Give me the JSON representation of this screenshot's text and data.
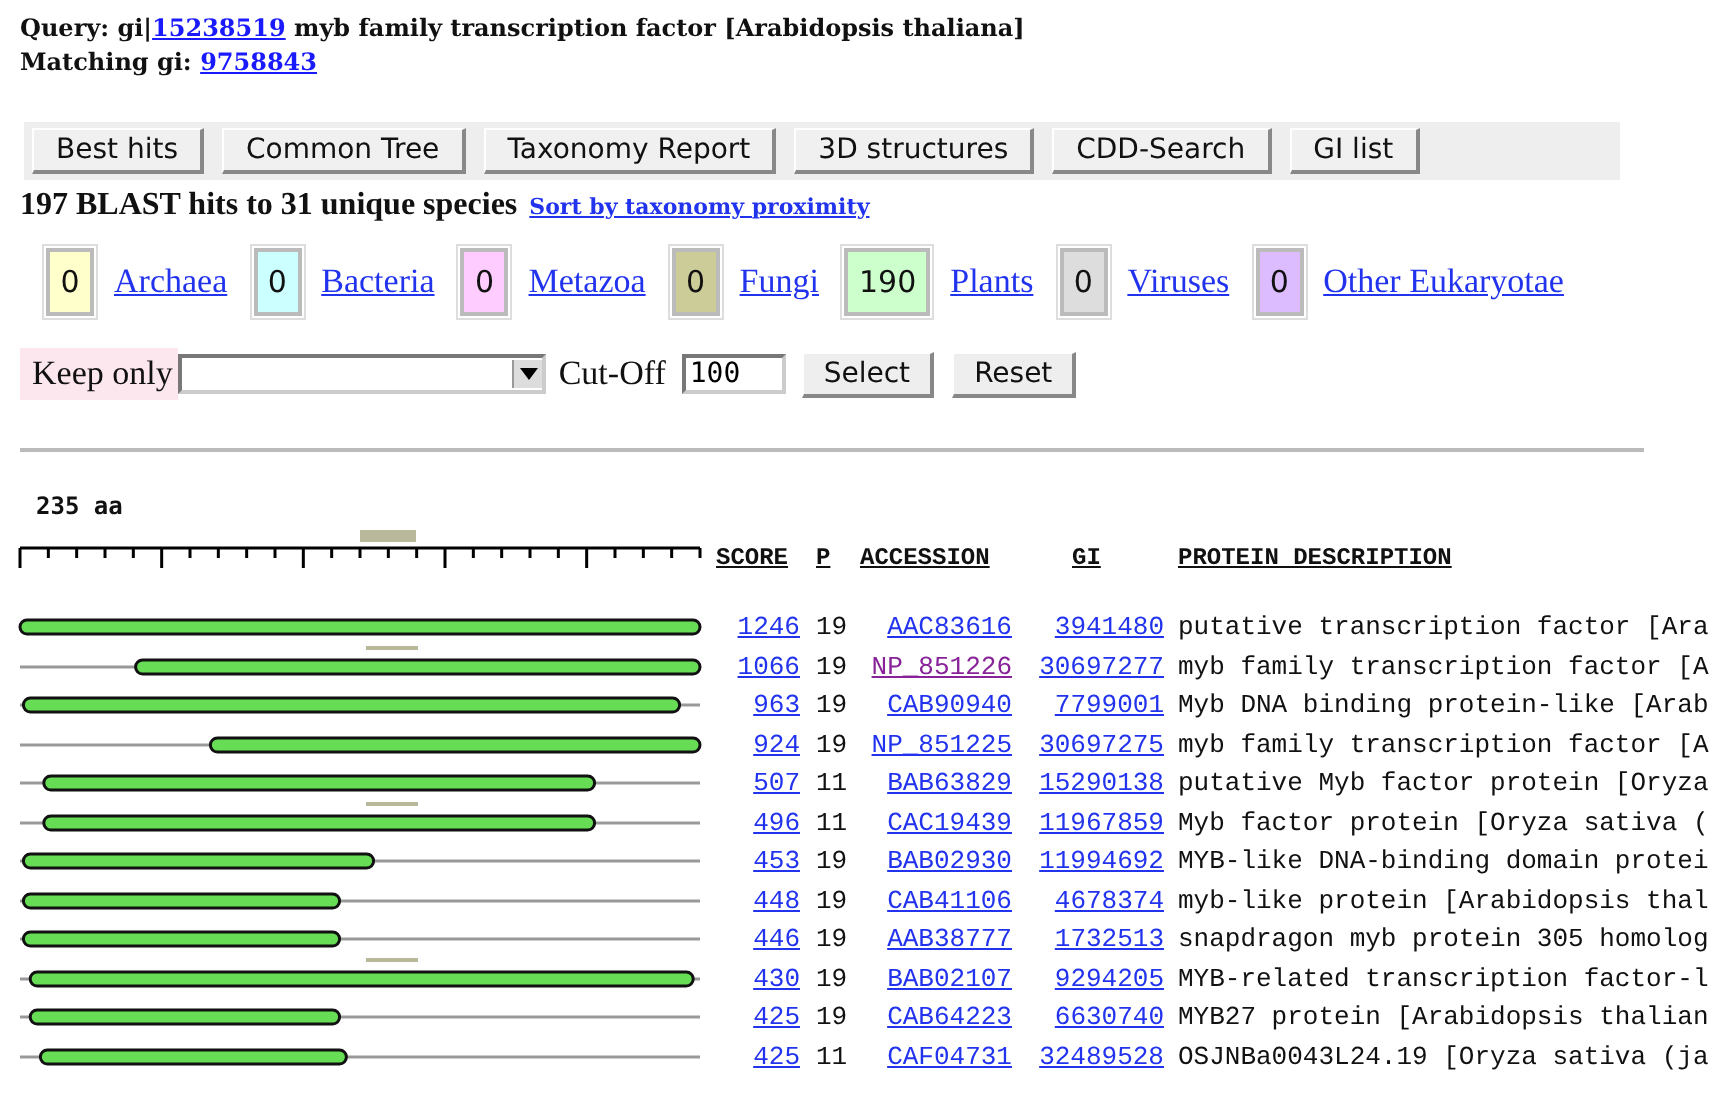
{
  "query": {
    "label": "Query: gi|",
    "gi": "15238519",
    "description": "myb family transcription factor [Arabidopsis thaliana]"
  },
  "matching": {
    "label": "Matching gi:",
    "gi": "9758843"
  },
  "buttons": [
    "Best hits",
    "Common Tree",
    "Taxonomy Report",
    "3D structures",
    "CDD-Search",
    "GI list"
  ],
  "summary": {
    "text": "197 BLAST hits to 31 unique species",
    "link": "Sort by taxonomy proximity"
  },
  "taxa": [
    {
      "count": "0",
      "name": "Archaea",
      "color": "#ffffcc"
    },
    {
      "count": "0",
      "name": "Bacteria",
      "color": "#ccffff"
    },
    {
      "count": "0",
      "name": "Metazoa",
      "color": "#ffccff"
    },
    {
      "count": "0",
      "name": "Fungi",
      "color": "#cccc99"
    },
    {
      "count": "190",
      "name": "Plants",
      "color": "#ccffcc"
    },
    {
      "count": "0",
      "name": "Viruses",
      "color": "#dddddd"
    },
    {
      "count": "0",
      "name": "Other Eukaryotae",
      "color": "#ddbbff"
    }
  ],
  "filter": {
    "label": "Keep only",
    "cutoff_label": "Cut-Off",
    "cutoff_value": "100",
    "buttons": [
      "Select",
      "Reset"
    ]
  },
  "sequence_length": "235 aa",
  "columns": [
    "SCORE",
    "P",
    "ACCESSION",
    "GI",
    "PROTEIN DESCRIPTION"
  ],
  "hits": [
    {
      "score": "1246",
      "p": "19",
      "accession": "AAC83616",
      "gi": "3941480",
      "description": "putative transcription factor [Ara",
      "visited": false
    },
    {
      "score": "1066",
      "p": "19",
      "accession": "NP_851226",
      "gi": "30697277",
      "description": "myb family transcription factor [A",
      "visited": true
    },
    {
      "score": "963",
      "p": "19",
      "accession": "CAB90940",
      "gi": "7799001",
      "description": "Myb DNA binding protein-like [Arab",
      "visited": false
    },
    {
      "score": "924",
      "p": "19",
      "accession": "NP_851225",
      "gi": "30697275",
      "description": "myb family transcription factor [A",
      "visited": false
    },
    {
      "score": "507",
      "p": "11",
      "accession": "BAB63829",
      "gi": "15290138",
      "description": "putative Myb factor protein [Oryza",
      "visited": false
    },
    {
      "score": "496",
      "p": "11",
      "accession": "CAC19439",
      "gi": "11967859",
      "description": "Myb factor protein [Oryza sativa (",
      "visited": false
    },
    {
      "score": "453",
      "p": "19",
      "accession": "BAB02930",
      "gi": "11994692",
      "description": "MYB-like DNA-binding domain protei",
      "visited": false
    },
    {
      "score": "448",
      "p": "19",
      "accession": "CAB41106",
      "gi": "4678374",
      "description": "myb-like protein [Arabidopsis thal",
      "visited": false
    },
    {
      "score": "446",
      "p": "19",
      "accession": "AAB38777",
      "gi": "1732513",
      "description": "snapdragon myb protein 305 homolog",
      "visited": false
    },
    {
      "score": "430",
      "p": "19",
      "accession": "BAB02107",
      "gi": "9294205",
      "description": "MYB-related transcription factor-l",
      "visited": false
    },
    {
      "score": "425",
      "p": "19",
      "accession": "CAB64223",
      "gi": "6630740",
      "description": "MYB27 protein [Arabidopsis thalian",
      "visited": false
    },
    {
      "score": "425",
      "p": "11",
      "accession": "CAF04731",
      "gi": "32489528",
      "description": "OSJNBa0043L24.19 [Oryza sativa (ja",
      "visited": false
    }
  ]
}
